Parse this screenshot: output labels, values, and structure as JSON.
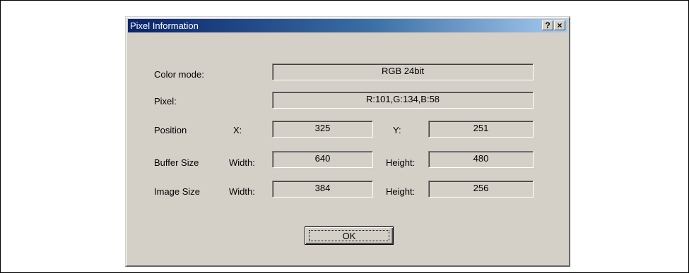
{
  "window": {
    "title": "Pixel Information",
    "help_label": "?",
    "close_label": "×"
  },
  "color_mode": {
    "label": "Color mode:",
    "value": "RGB 24bit"
  },
  "pixel": {
    "label": "Pixel:",
    "value": "R:101,G:134,B:58"
  },
  "position": {
    "label": "Position",
    "x_label": "X:",
    "x_value": "325",
    "y_label": "Y:",
    "y_value": "251"
  },
  "buffer_size": {
    "label": "Buffer Size",
    "width_label": "Width:",
    "width_value": "640",
    "height_label": "Height:",
    "height_value": "480"
  },
  "image_size": {
    "label": "Image Size",
    "width_label": "Width:",
    "width_value": "384",
    "height_label": "Height:",
    "height_value": "256"
  },
  "ok_button": {
    "label": "OK"
  },
  "colors": {
    "face": "#d4d0c8",
    "title_start": "#0a246a",
    "title_end": "#a6caf0",
    "title_text": "#ffffff"
  }
}
